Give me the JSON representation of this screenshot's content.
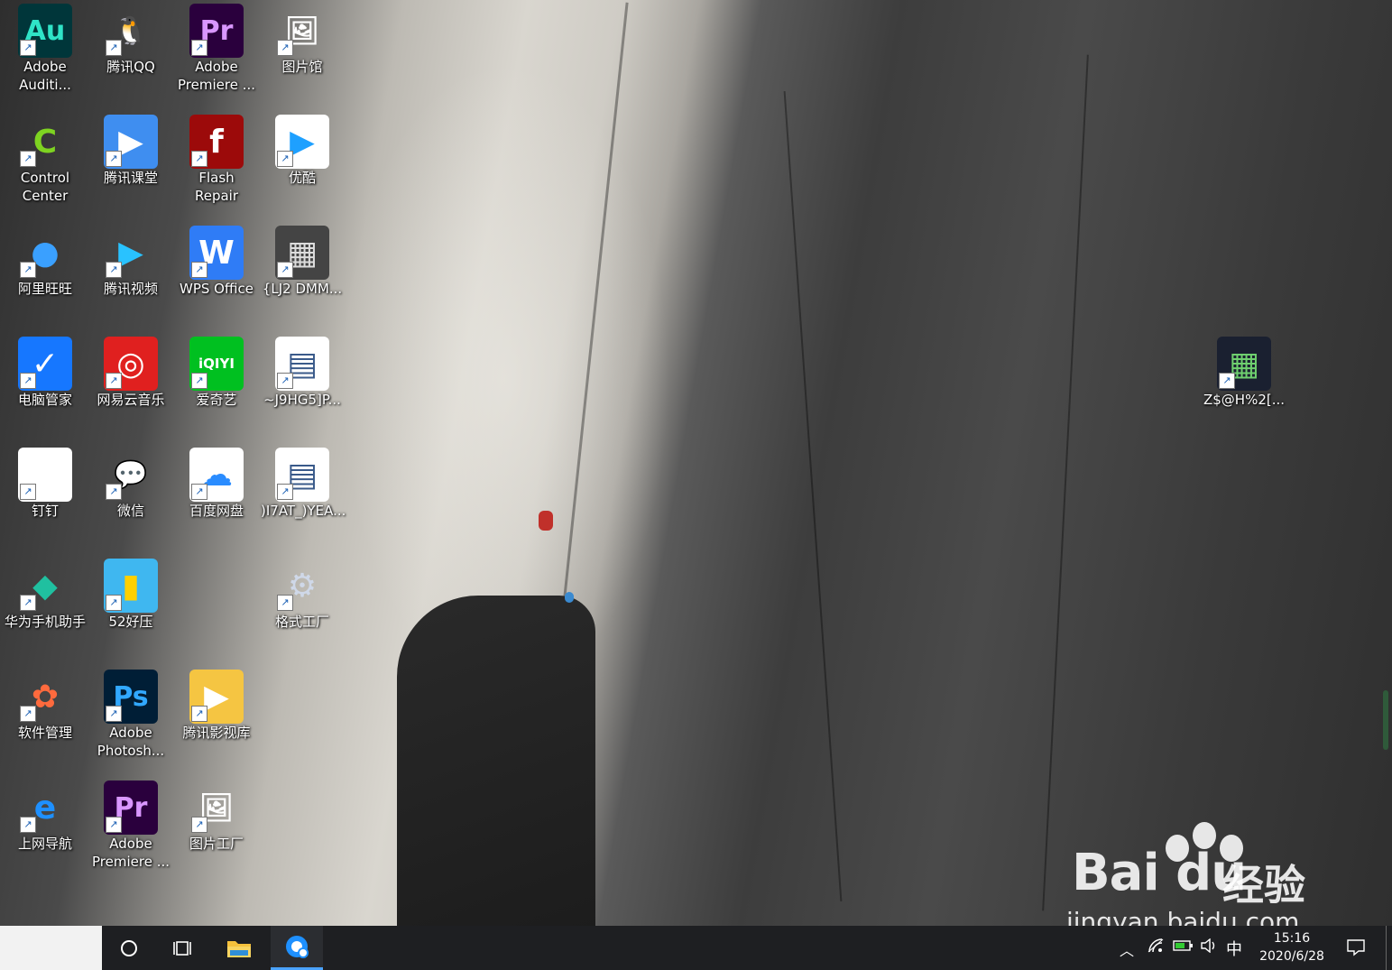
{
  "desktop": {
    "icons": [
      {
        "label": "Adobe Auditi...",
        "icon": "adobe-audition-icon",
        "glyph": "Au",
        "bg": "#00363a",
        "fg": "#2fe3c7"
      },
      {
        "label": "腾讯QQ",
        "icon": "qq-penguin-icon",
        "glyph": "🐧",
        "bg": "transparent",
        "fg": "#000000"
      },
      {
        "label": "Adobe Premiere ...",
        "icon": "adobe-premiere-icon",
        "glyph": "Pr",
        "bg": "#2a003d",
        "fg": "#d997ff"
      },
      {
        "label": "图片馆",
        "icon": "photo-gallery-icon",
        "glyph": "🖼",
        "bg": "transparent",
        "fg": "#ffffff"
      },
      {
        "label": "Control Center",
        "icon": "control-center-icon",
        "glyph": "C",
        "bg": "transparent",
        "fg": "#7ed321"
      },
      {
        "label": "腾讯课堂",
        "icon": "tencent-classroom-icon",
        "glyph": "▶",
        "bg": "#3f8ef0",
        "fg": "#ffffff"
      },
      {
        "label": "Flash Repair",
        "icon": "flash-repair-icon",
        "glyph": "f",
        "bg": "#9c0a0a",
        "fg": "#ffffff"
      },
      {
        "label": "优酷",
        "icon": "youku-icon",
        "glyph": "▶",
        "bg": "#ffffff",
        "fg": "#1ea0ff"
      },
      {
        "label": "阿里旺旺",
        "icon": "aliwangwang-icon",
        "glyph": "●",
        "bg": "transparent",
        "fg": "#3aa0ff"
      },
      {
        "label": "腾讯视频",
        "icon": "tencent-video-icon",
        "glyph": "▶",
        "bg": "transparent",
        "fg": "#29c2ff"
      },
      {
        "label": "WPS Office",
        "icon": "wps-office-icon",
        "glyph": "W",
        "bg": "#2f7cf6",
        "fg": "#ffffff"
      },
      {
        "label": "{LJ2 DMM...",
        "icon": "image-file-icon",
        "glyph": "▦",
        "bg": "#444444",
        "fg": "#dddddd"
      },
      {
        "label": "电脑管家",
        "icon": "pc-manager-icon",
        "glyph": "✓",
        "bg": "#1677ff",
        "fg": "#ffffff"
      },
      {
        "label": "网易云音乐",
        "icon": "netease-music-icon",
        "glyph": "◎",
        "bg": "#e0201f",
        "fg": "#ffffff"
      },
      {
        "label": "爱奇艺",
        "icon": "iqiyi-icon",
        "glyph": "iQIYI",
        "bg": "#00c020",
        "fg": "#ffffff"
      },
      {
        "label": "~J9HG5]P...",
        "icon": "screenshot-file-icon",
        "glyph": "▤",
        "bg": "#ffffff",
        "fg": "#3a5a8a"
      },
      {
        "label": "钉钉",
        "icon": "blank-document-icon",
        "glyph": "",
        "bg": "#ffffff",
        "fg": "#cccccc"
      },
      {
        "label": "微信",
        "icon": "wechat-icon",
        "glyph": "💬",
        "bg": "transparent",
        "fg": "#7bd23c"
      },
      {
        "label": "百度网盘",
        "icon": "baidu-netdisk-icon",
        "glyph": "☁",
        "bg": "#ffffff",
        "fg": "#2a8cff"
      },
      {
        "label": ")I7AT_)YEA...",
        "icon": "screenshot-file-icon",
        "glyph": "▤",
        "bg": "#ffffff",
        "fg": "#3a5a8a"
      },
      {
        "label": "华为手机助手",
        "icon": "huawei-assistant-icon",
        "glyph": "◆",
        "bg": "transparent",
        "fg": "#20c0a0"
      },
      {
        "label": "52好压",
        "icon": "haozip-icon",
        "glyph": "▮",
        "bg": "#3fb7f0",
        "fg": "#ffd000"
      },
      {
        "label": "格式工厂",
        "icon": "format-factory-icon",
        "glyph": "⚙",
        "bg": "transparent",
        "fg": "#cfd8e8"
      },
      {
        "label": "软件管理",
        "icon": "software-manager-icon",
        "glyph": "✿",
        "bg": "transparent",
        "fg": "#ff6a3d"
      },
      {
        "label": "Adobe Photosh...",
        "icon": "adobe-photoshop-icon",
        "glyph": "Ps",
        "bg": "#001e36",
        "fg": "#31a8ff"
      },
      {
        "label": "腾讯影视库",
        "icon": "tencent-media-folder-icon",
        "glyph": "▶",
        "bg": "#f5c542",
        "fg": "#ffffff"
      },
      {
        "label": "上网导航",
        "icon": "internet-explorer-icon",
        "glyph": "e",
        "bg": "transparent",
        "fg": "#1e90ff"
      },
      {
        "label": "Adobe Premiere ...",
        "icon": "adobe-premiere-icon",
        "glyph": "Pr",
        "bg": "#2a003d",
        "fg": "#d997ff"
      },
      {
        "label": "图片工厂",
        "icon": "photo-factory-icon",
        "glyph": "🖼",
        "bg": "transparent",
        "fg": "#ffffff"
      },
      {
        "label": "Z$@H%2[...",
        "icon": "night-photo-file-icon",
        "glyph": "▦",
        "bg": "#1a2030",
        "fg": "#6fd06f"
      }
    ]
  },
  "taskbar": {
    "time": "15:16",
    "date": "2020/6/28",
    "ime": "中"
  },
  "watermark": {
    "brand": "Bai du",
    "cn": "经验",
    "url": "jingyan.baidu.com"
  }
}
